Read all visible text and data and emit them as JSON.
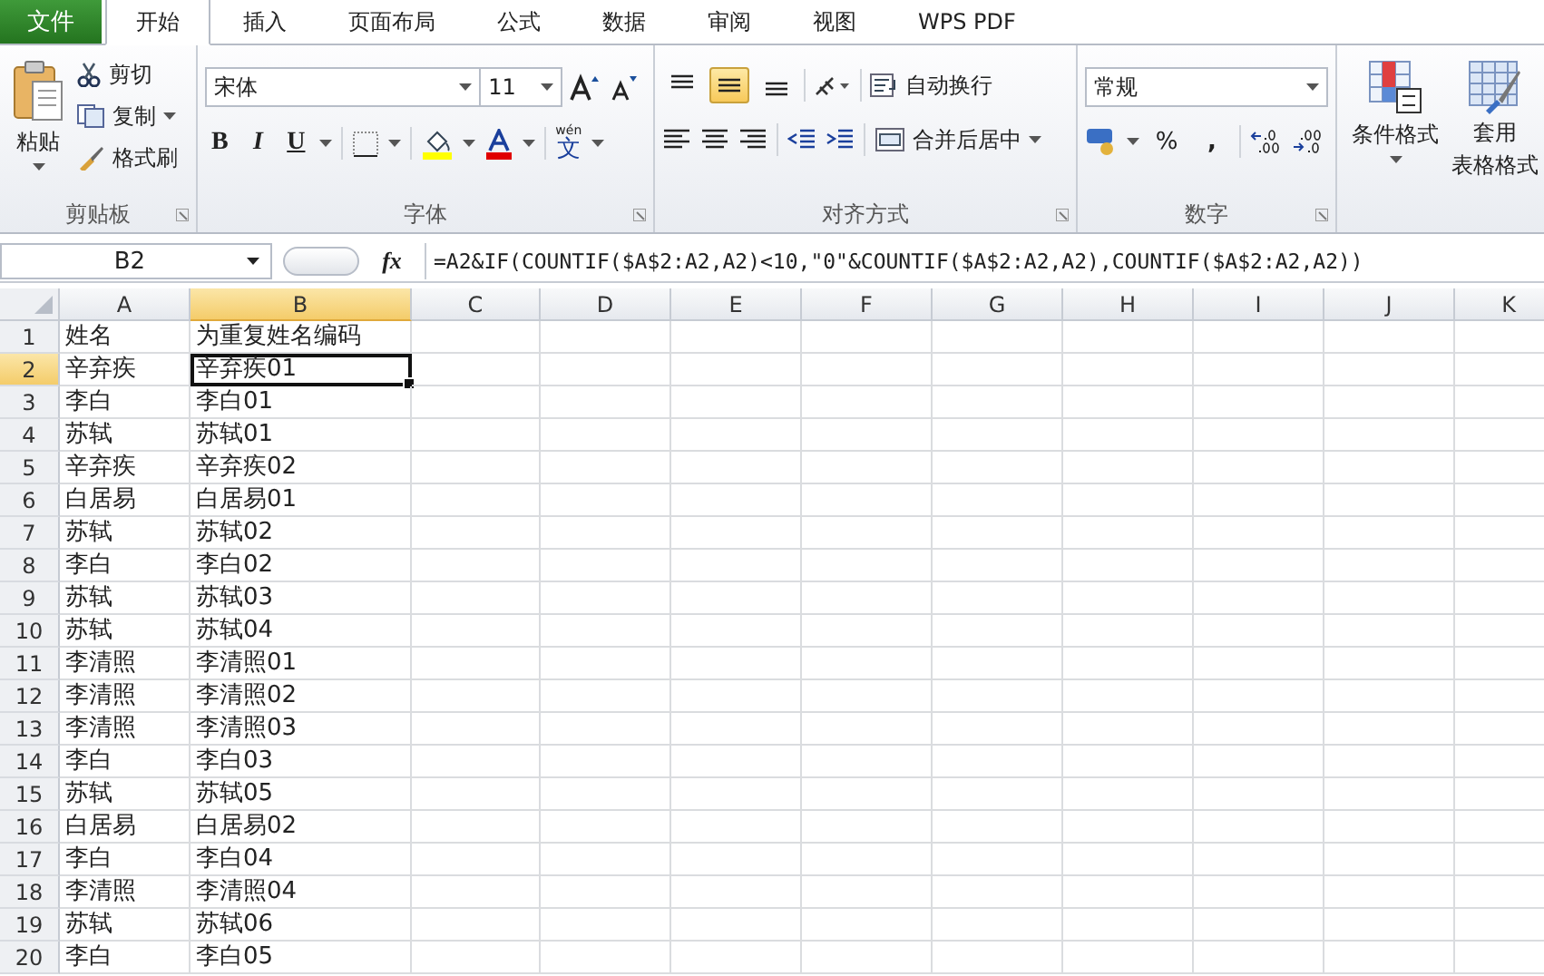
{
  "file_tab": "文件",
  "tabs": [
    {
      "label": "开始",
      "selected": true
    },
    {
      "label": "插入",
      "selected": false
    },
    {
      "label": "页面布局",
      "selected": false
    },
    {
      "label": "公式",
      "selected": false
    },
    {
      "label": "数据",
      "selected": false
    },
    {
      "label": "审阅",
      "selected": false
    },
    {
      "label": "视图",
      "selected": false
    },
    {
      "label": "WPS PDF",
      "selected": false
    }
  ],
  "clipboard": {
    "label": "剪贴板",
    "paste": "粘贴",
    "cut": "剪切",
    "copy": "复制",
    "format_painter": "格式刷"
  },
  "font": {
    "label": "字体",
    "font_name": "宋体",
    "font_size": "11",
    "bold": "B",
    "italic": "I",
    "underline": "U",
    "phonetic_ruby": "wén",
    "phonetic_char": "文"
  },
  "alignment": {
    "label": "对齐方式",
    "vertical": [
      {
        "selected": false
      },
      {
        "selected": true
      },
      {
        "selected": false
      }
    ],
    "wrap_text": "自动换行",
    "merge_center": "合并后居中"
  },
  "number": {
    "label": "数字",
    "format": "常规",
    "percent": "%",
    "comma": ","
  },
  "styles": {
    "conditional_format": "条件格式",
    "table_format": [
      "套用",
      "表格格式"
    ]
  },
  "formula_bar": {
    "name_box": "B2",
    "fx": "fx",
    "formula": "=A2&IF(COUNTIF($A$2:A2,A2)<10,\"0\"&COUNTIF($A$2:A2,A2),COUNTIF($A$2:A2,A2))"
  },
  "columns": [
    {
      "label": "A",
      "selected": false
    },
    {
      "label": "B",
      "selected": true
    },
    {
      "label": "C",
      "selected": false
    },
    {
      "label": "D",
      "selected": false
    },
    {
      "label": "E",
      "selected": false
    },
    {
      "label": "F",
      "selected": false
    },
    {
      "label": "G",
      "selected": false
    },
    {
      "label": "H",
      "selected": false
    },
    {
      "label": "I",
      "selected": false
    },
    {
      "label": "J",
      "selected": false
    },
    {
      "label": "K",
      "selected": false
    }
  ],
  "rows": [
    {
      "number": "1",
      "selected": false,
      "cells": [
        "姓名",
        "为重复姓名编码"
      ]
    },
    {
      "number": "2",
      "selected": true,
      "cells": [
        "辛弃疾",
        "辛弃疾01"
      ]
    },
    {
      "number": "3",
      "selected": false,
      "cells": [
        "李白",
        "李白01"
      ]
    },
    {
      "number": "4",
      "selected": false,
      "cells": [
        "苏轼",
        "苏轼01"
      ]
    },
    {
      "number": "5",
      "selected": false,
      "cells": [
        "辛弃疾",
        "辛弃疾02"
      ]
    },
    {
      "number": "6",
      "selected": false,
      "cells": [
        "白居易",
        "白居易01"
      ]
    },
    {
      "number": "7",
      "selected": false,
      "cells": [
        "苏轼",
        "苏轼02"
      ]
    },
    {
      "number": "8",
      "selected": false,
      "cells": [
        "李白",
        "李白02"
      ]
    },
    {
      "number": "9",
      "selected": false,
      "cells": [
        "苏轼",
        "苏轼03"
      ]
    },
    {
      "number": "10",
      "selected": false,
      "cells": [
        "苏轼",
        "苏轼04"
      ]
    },
    {
      "number": "11",
      "selected": false,
      "cells": [
        "李清照",
        "李清照01"
      ]
    },
    {
      "number": "12",
      "selected": false,
      "cells": [
        "李清照",
        "李清照02"
      ]
    },
    {
      "number": "13",
      "selected": false,
      "cells": [
        "李清照",
        "李清照03"
      ]
    },
    {
      "number": "14",
      "selected": false,
      "cells": [
        "李白",
        "李白03"
      ]
    },
    {
      "number": "15",
      "selected": false,
      "cells": [
        "苏轼",
        "苏轼05"
      ]
    },
    {
      "number": "16",
      "selected": false,
      "cells": [
        "白居易",
        "白居易02"
      ]
    },
    {
      "number": "17",
      "selected": false,
      "cells": [
        "李白",
        "李白04"
      ]
    },
    {
      "number": "18",
      "selected": false,
      "cells": [
        "李清照",
        "李清照04"
      ]
    },
    {
      "number": "19",
      "selected": false,
      "cells": [
        "苏轼",
        "苏轼06"
      ]
    },
    {
      "number": "20",
      "selected": false,
      "cells": [
        "李白",
        "李白05"
      ]
    }
  ]
}
